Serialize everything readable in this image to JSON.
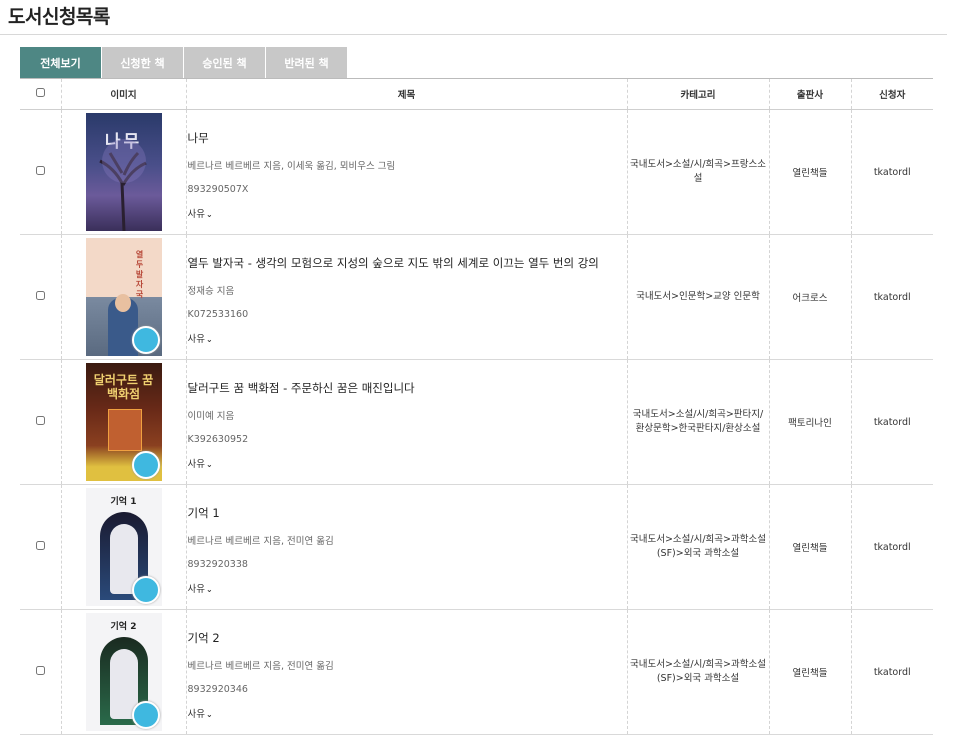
{
  "page": {
    "title": "도서신청목록"
  },
  "tabs": [
    {
      "label": "전체보기",
      "active": true
    },
    {
      "label": "신청한 책",
      "active": false
    },
    {
      "label": "승인된 책",
      "active": false
    },
    {
      "label": "반려된 책",
      "active": false
    }
  ],
  "table": {
    "headers": {
      "image": "이미지",
      "title": "제목",
      "category": "카테고리",
      "publisher": "출판사",
      "requester": "신청자"
    },
    "reason_label": "사유",
    "rows": [
      {
        "cover_title": "나무",
        "title": "나무",
        "author": "베르나르 베르베르 지음, 이세욱 옮김, 뫼비우스 그림",
        "isbn": "893290507X",
        "category": "국내도서>소설/시/희곡>프랑스소설",
        "publisher": "열린책들",
        "requester": "tkatordl"
      },
      {
        "cover_title": "열두 발자국",
        "title": "열두 발자국 - 생각의 모험으로 지성의 숲으로 지도 밖의 세계로 이끄는 열두 번의 강의",
        "author": "정재승 지음",
        "isbn": "K072533160",
        "category": "국내도서>인문학>교양 인문학",
        "publisher": "어크로스",
        "requester": "tkatordl"
      },
      {
        "cover_title": "달러구트 꿈 백화점",
        "title": "달러구트 꿈 백화점 - 주문하신 꿈은 매진입니다",
        "author": "이미예 지음",
        "isbn": "K392630952",
        "category": "국내도서>소설/시/희곡>판타지/환상문학>한국판타지/환상소설",
        "publisher": "팩토리나인",
        "requester": "tkatordl"
      },
      {
        "cover_title": "기억 1",
        "title": "기억 1",
        "author": "베르나르 베르베르 지음, 전미연 옮김",
        "isbn": "8932920338",
        "category": "국내도서>소설/시/희곡>과학소설(SF)>외국 과학소설",
        "publisher": "열린책들",
        "requester": "tkatordl"
      },
      {
        "cover_title": "기억 2",
        "title": "기억 2",
        "author": "베르나르 베르베르 지음, 전미연 옮김",
        "isbn": "8932920346",
        "category": "국내도서>소설/시/희곡>과학소설(SF)>외국 과학소설",
        "publisher": "열린책들",
        "requester": "tkatordl"
      }
    ]
  },
  "colors": {
    "active_tab": "#4e8784",
    "inactive_tab": "#c8c8c8",
    "badge": "#3fb8e0"
  }
}
